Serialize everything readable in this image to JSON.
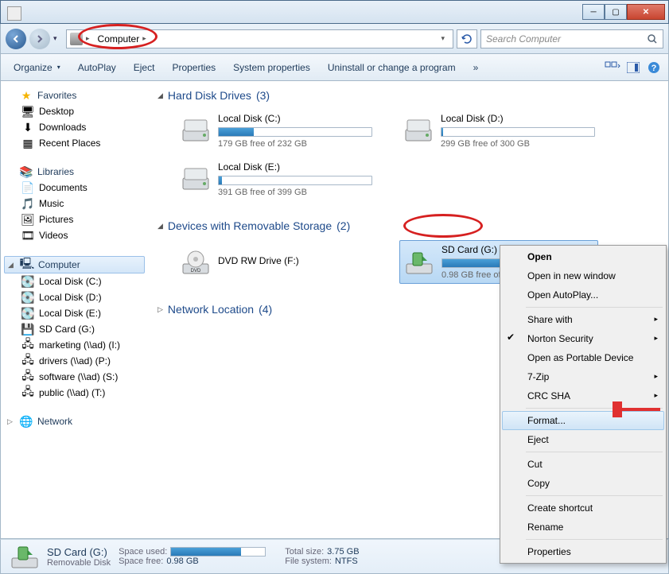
{
  "address": {
    "crumb": "Computer"
  },
  "search": {
    "placeholder": "Search Computer"
  },
  "toolbar": {
    "organize": "Organize",
    "autoplay": "AutoPlay",
    "eject": "Eject",
    "properties": "Properties",
    "system_properties": "System properties",
    "uninstall": "Uninstall or change a program",
    "more": "»"
  },
  "sidebar": {
    "favorites": {
      "label": "Favorites",
      "items": [
        "Desktop",
        "Downloads",
        "Recent Places"
      ]
    },
    "libraries": {
      "label": "Libraries",
      "items": [
        "Documents",
        "Music",
        "Pictures",
        "Videos"
      ]
    },
    "computer": {
      "label": "Computer",
      "items": [
        "Local Disk (C:)",
        "Local Disk (D:)",
        "Local Disk (E:)",
        "SD Card (G:)",
        "marketing (\\\\ad) (I:)",
        "drivers (\\\\ad) (P:)",
        "software (\\\\ad) (S:)",
        "public (\\\\ad) (T:)"
      ]
    },
    "network": {
      "label": "Network"
    }
  },
  "sections": {
    "hdd": {
      "label": "Hard Disk Drives",
      "count": "(3)",
      "drives": [
        {
          "name": "Local Disk (C:)",
          "free": "179 GB free of 232 GB",
          "pct": 23
        },
        {
          "name": "Local Disk (D:)",
          "free": "299 GB free of 300 GB",
          "pct": 1
        },
        {
          "name": "Local Disk (E:)",
          "free": "391 GB free of 399 GB",
          "pct": 2
        }
      ]
    },
    "removable": {
      "label": "Devices with Removable Storage",
      "count": "(2)",
      "drives": [
        {
          "name": "DVD RW Drive (F:)",
          "nobar": true
        },
        {
          "name": "SD Card (G:)",
          "free": "0.98 GB free of 3.75 GB",
          "pct": 74,
          "selected": true
        }
      ]
    },
    "network": {
      "label": "Network Location",
      "count": "(4)"
    }
  },
  "ctx": {
    "open": "Open",
    "open_new": "Open in new window",
    "autoplay": "Open AutoPlay...",
    "share": "Share with",
    "norton": "Norton Security",
    "portable": "Open as Portable Device",
    "sevenzip": "7-Zip",
    "crc": "CRC SHA",
    "format": "Format...",
    "eject": "Eject",
    "cut": "Cut",
    "copy": "Copy",
    "shortcut": "Create shortcut",
    "rename": "Rename",
    "properties": "Properties"
  },
  "details": {
    "title": "SD Card (G:)",
    "subtitle": "Removable Disk",
    "space_used_lbl": "Space used:",
    "space_free_lbl": "Space free:",
    "space_free": "0.98 GB",
    "total_lbl": "Total size:",
    "total": "3.75 GB",
    "fs_lbl": "File system:",
    "fs": "NTFS"
  }
}
